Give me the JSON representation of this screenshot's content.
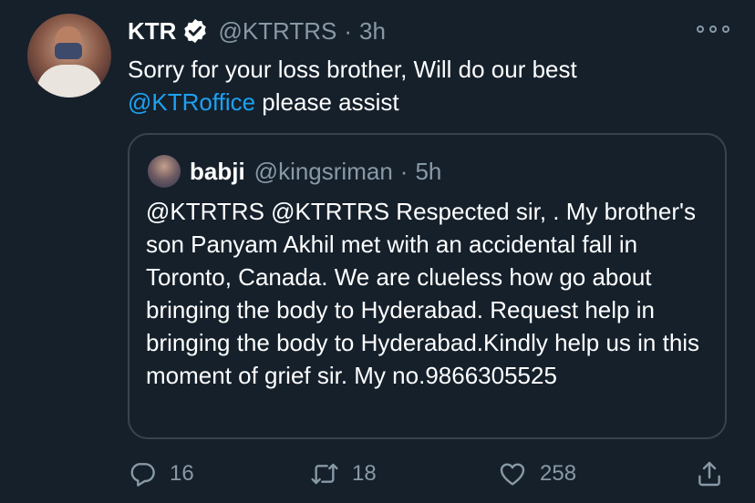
{
  "tweet": {
    "author_name": "KTR",
    "author_handle": "@KTRTRS",
    "separator": "·",
    "time": "3h",
    "text_line1": "Sorry for your loss brother, Will do our best",
    "mention": "@KTRoffice",
    "text_after_mention": " please assist"
  },
  "quoted_tweet": {
    "author_name": "babji",
    "author_handle": "@kingsriman",
    "separator": "·",
    "time": "5h",
    "text": "@KTRTRS @KTRTRS Respected sir, . My brother's son Panyam Akhil met with an accidental fall in Toronto, Canada. We are clueless how go about bringing the body to Hyderabad. Request help in bringing the body to Hyderabad.Kindly help us in this moment of grief sir. My no.9866305525"
  },
  "actions": {
    "reply_count": "16",
    "retweet_count": "18",
    "like_count": "258"
  },
  "icons": {
    "verified": "verified-badge-icon",
    "more": "more-options-icon",
    "reply": "reply-icon",
    "retweet": "retweet-icon",
    "like": "heart-icon",
    "share": "share-icon"
  },
  "colors": {
    "background": "#15202b",
    "text": "#ffffff",
    "secondary": "#8899a6",
    "link": "#1da1f2",
    "border": "#38444d"
  }
}
